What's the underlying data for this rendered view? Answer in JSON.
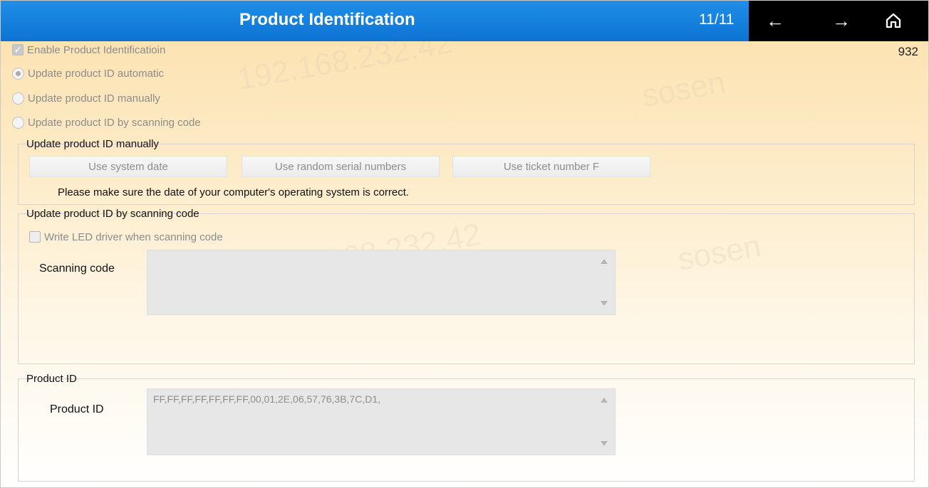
{
  "header": {
    "title": "Product Identification",
    "page_count": "11/11",
    "prev_icon": "arrow-left-icon",
    "next_icon": "arrow-right-icon",
    "home_icon": "home-icon"
  },
  "counter": "932",
  "options": {
    "enable_label": "Enable Product Identificatioin",
    "auto_label": "Update product ID automatic",
    "manual_label": "Update product ID manually",
    "scan_label": "Update product ID by scanning code",
    "selected": "auto"
  },
  "manual_group": {
    "title": "Update product ID manually",
    "buttons": [
      "Use system date",
      "Use random serial numbers",
      "Use ticket number F"
    ],
    "note": "Please make sure the date of your computer's operating system is correct."
  },
  "scan_group": {
    "title": "Update product ID by scanning code",
    "write_led_label": "Write LED driver when scanning code",
    "scanning_code_label": "Scanning code",
    "scanning_code_value": ""
  },
  "product_group": {
    "title": "Product ID",
    "label": "Product ID",
    "value": "FF,FF,FF,FF,FF,FF,FF,00,01,2E,06,57,76,3B,7C,D1,"
  },
  "colors": {
    "title_bar": "#0d73d3",
    "nav_bar": "#000000",
    "background_top": "#fce3b3"
  }
}
